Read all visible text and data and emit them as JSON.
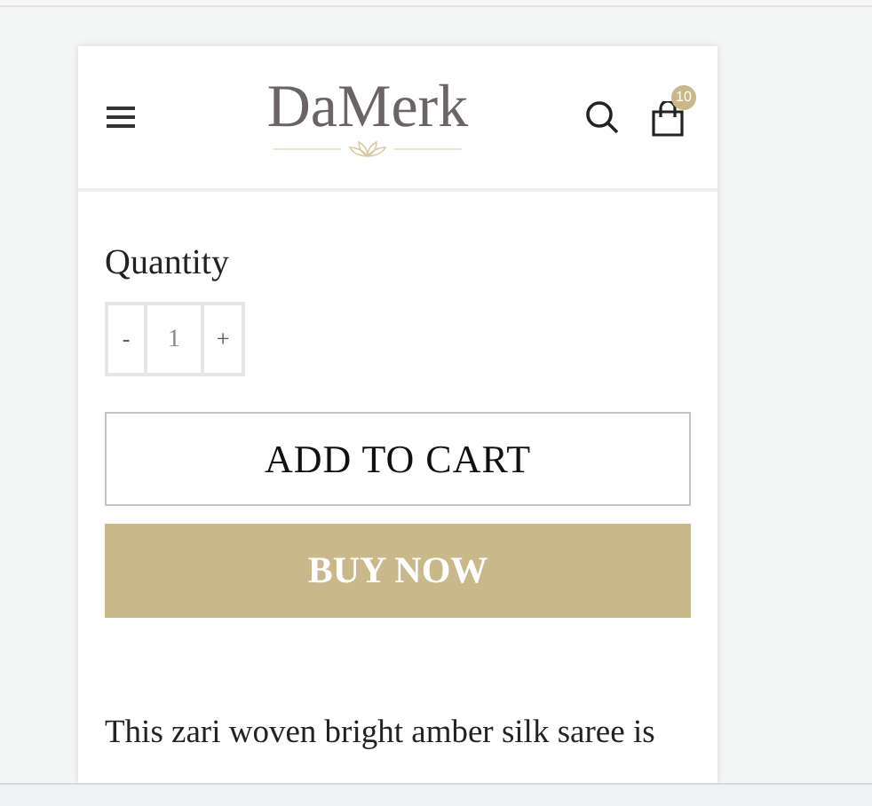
{
  "header": {
    "logo": "DaMerk",
    "cart_count": "10"
  },
  "quantity": {
    "label": "Quantity",
    "decrement": "-",
    "value": "1",
    "increment": "+"
  },
  "buttons": [
    {
      "kind": "outline",
      "label": "ADD TO CART"
    },
    {
      "kind": "filled",
      "label": "BUY NOW"
    }
  ],
  "description": "This zari woven bright amber silk saree is"
}
